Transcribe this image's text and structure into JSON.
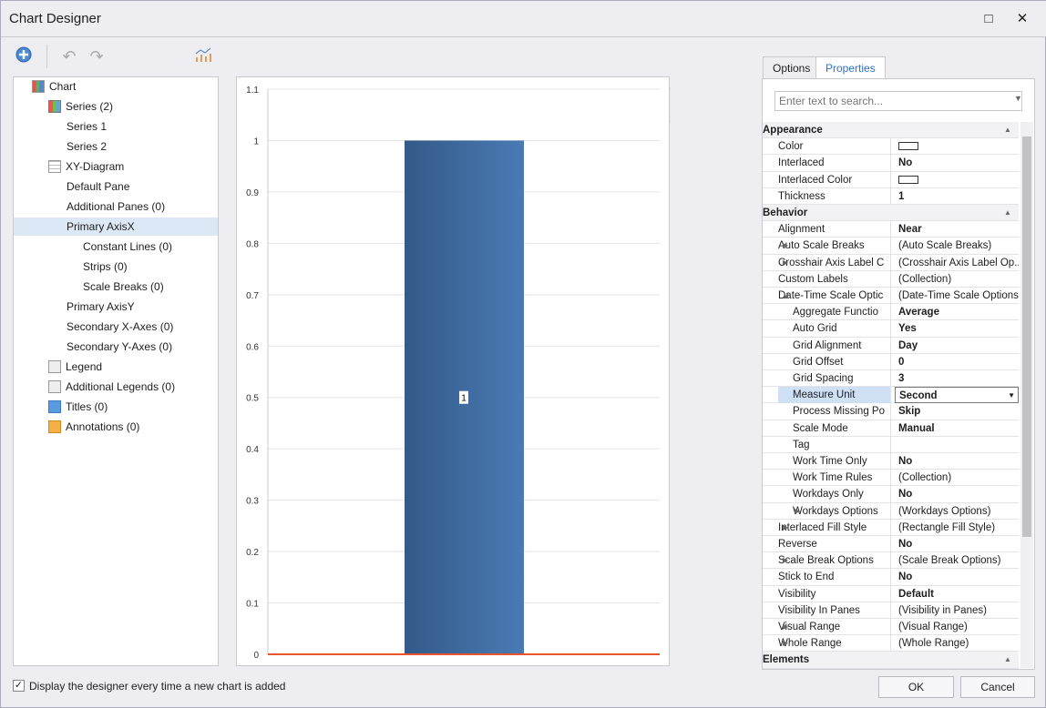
{
  "window": {
    "title": "Chart Designer",
    "maximize_icon": "□",
    "close_icon": "✕"
  },
  "toolbar": {
    "add_icon": "plus-circle",
    "undo_icon": "undo",
    "redo_icon": "redo",
    "wizard_icon": "chart-wizard"
  },
  "tree": [
    {
      "label": "Chart",
      "level": 0,
      "icon": "chart"
    },
    {
      "label": "Series (2)",
      "level": 1,
      "icon": "series"
    },
    {
      "label": "Series 1",
      "level": 2
    },
    {
      "label": "Series 2",
      "level": 2
    },
    {
      "label": "XY-Diagram",
      "level": 1,
      "icon": "grid"
    },
    {
      "label": "Default Pane",
      "level": 2
    },
    {
      "label": "Additional Panes (0)",
      "level": 2
    },
    {
      "label": "Primary AxisX",
      "level": 2,
      "selected": true
    },
    {
      "label": "Constant Lines (0)",
      "level": 3
    },
    {
      "label": "Strips (0)",
      "level": 3
    },
    {
      "label": "Scale Breaks (0)",
      "level": 3
    },
    {
      "label": "Primary AxisY",
      "level": 2
    },
    {
      "label": "Secondary X-Axes (0)",
      "level": 2
    },
    {
      "label": "Secondary Y-Axes (0)",
      "level": 2
    },
    {
      "label": "Legend",
      "level": 1,
      "icon": "legend"
    },
    {
      "label": "Additional Legends (0)",
      "level": 1,
      "icon": "legend"
    },
    {
      "label": "Titles (0)",
      "level": 1,
      "icon": "title"
    },
    {
      "label": "Annotations (0)",
      "level": 1,
      "icon": "annotation"
    }
  ],
  "chart_data": {
    "type": "bar",
    "categories": [
      ""
    ],
    "series": [
      {
        "name": "Series 1",
        "values": [
          1
        ],
        "color": "#4a7ab5"
      },
      {
        "name": "Series 2",
        "values": [
          0
        ],
        "color": "#b5403d"
      }
    ],
    "bar_label": "1",
    "ylim": [
      0,
      1.1
    ],
    "yticks": [
      "0",
      "0.1",
      "0.2",
      "0.3",
      "0.4",
      "0.5",
      "0.6",
      "0.7",
      "0.8",
      "0.9",
      "1",
      "1.1"
    ],
    "grid": true,
    "legend": "top-right",
    "axis_color": "#e8542e"
  },
  "tabs": [
    {
      "label": "Options"
    },
    {
      "label": "Properties",
      "active": true
    }
  ],
  "search": {
    "placeholder": "Enter text to search..."
  },
  "properties": [
    {
      "cat": "Appearance"
    },
    {
      "n": "Color",
      "swatch": "#ffffff"
    },
    {
      "n": "Interlaced",
      "v": "No",
      "b": true
    },
    {
      "n": "Interlaced Color",
      "swatch": "#ffffff"
    },
    {
      "n": "Thickness",
      "v": "1",
      "b": true
    },
    {
      "cat": "Behavior"
    },
    {
      "n": "Alignment",
      "v": "Near",
      "b": true
    },
    {
      "n": "Auto Scale Breaks",
      "v": "(Auto Scale Breaks)",
      "e": "c"
    },
    {
      "n": "Crosshair Axis Label C",
      "v": "(Crosshair Axis Label Op...",
      "e": "c"
    },
    {
      "n": "Custom Labels",
      "v": "(Collection)"
    },
    {
      "n": "Date-Time Scale Optic",
      "v": "(Date-Time Scale Options)",
      "e": "o"
    },
    {
      "n": "Aggregate Functio",
      "v": "Average",
      "b": true,
      "i": 1
    },
    {
      "n": "Auto Grid",
      "v": "Yes",
      "b": true,
      "i": 1
    },
    {
      "n": "Grid Alignment",
      "v": "Day",
      "b": true,
      "i": 1
    },
    {
      "n": "Grid Offset",
      "v": "0",
      "b": true,
      "i": 1
    },
    {
      "n": "Grid Spacing",
      "v": "3",
      "b": true,
      "i": 1
    },
    {
      "n": "Measure Unit",
      "v": "Second",
      "b": true,
      "i": 1,
      "sel": true
    },
    {
      "n": "Process Missing Po",
      "v": "Skip",
      "b": true,
      "i": 1
    },
    {
      "n": "Scale Mode",
      "v": "Manual",
      "b": true,
      "i": 1
    },
    {
      "n": "Tag",
      "v": "",
      "i": 1
    },
    {
      "n": "Work Time Only",
      "v": "No",
      "b": true,
      "i": 1
    },
    {
      "n": "Work Time Rules",
      "v": "(Collection)",
      "i": 1
    },
    {
      "n": "Workdays Only",
      "v": "No",
      "b": true,
      "i": 1
    },
    {
      "n": "Workdays Options",
      "v": "(Workdays Options)",
      "i": 1,
      "e": "c"
    },
    {
      "n": "Interlaced Fill Style",
      "v": "(Rectangle Fill Style)",
      "e": "c"
    },
    {
      "n": "Reverse",
      "v": "No",
      "b": true
    },
    {
      "n": "Scale Break Options",
      "v": "(Scale Break Options)",
      "e": "c"
    },
    {
      "n": "Stick to End",
      "v": "No",
      "b": true
    },
    {
      "n": "Visibility",
      "v": "Default",
      "b": true
    },
    {
      "n": "Visibility In Panes",
      "v": "(Visibility in Panes)"
    },
    {
      "n": "Visual Range",
      "v": "(Visual Range)",
      "e": "c"
    },
    {
      "n": "Whole Range",
      "v": "(Whole Range)",
      "e": "c"
    },
    {
      "cat": "Elements"
    }
  ],
  "footer": {
    "checkbox_label": "Display the designer every time a new chart is added",
    "checked": true,
    "ok": "OK",
    "cancel": "Cancel"
  }
}
